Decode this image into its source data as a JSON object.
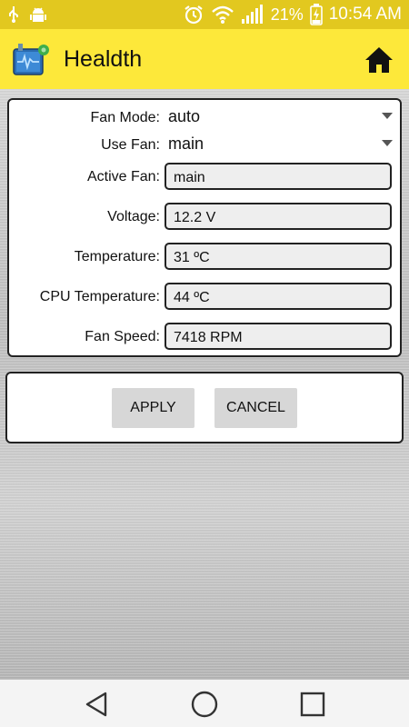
{
  "status_bar": {
    "battery": "21%",
    "time": "10:54 AM",
    "icons": [
      "usb-icon",
      "android-debug-icon",
      "alarm-icon",
      "wifi-icon",
      "signal-icon",
      "battery-charging-icon"
    ]
  },
  "app_bar": {
    "title": "Healdth",
    "logo": "app-logo-icon",
    "home_icon": "home-icon"
  },
  "form": {
    "fan_mode": {
      "label": "Fan Mode:",
      "value": "auto"
    },
    "use_fan": {
      "label": "Use Fan:",
      "value": "main"
    },
    "active_fan": {
      "label": "Active Fan:",
      "value": "main"
    },
    "voltage": {
      "label": "Voltage:",
      "value": "12.2 V"
    },
    "temperature": {
      "label": "Temperature:",
      "value": "31 ºC"
    },
    "cpu_temperature": {
      "label": "CPU Temperature:",
      "value": "44 ºC"
    },
    "fan_speed": {
      "label": "Fan Speed:",
      "value": "7418 RPM"
    }
  },
  "actions": {
    "apply_label": "APPLY",
    "cancel_label": "CANCEL"
  },
  "nav_bar": {
    "icons": [
      "back-icon",
      "home-circle-icon",
      "recents-icon"
    ]
  },
  "colors": {
    "status_bar": "#e2c81f",
    "app_bar": "#fde83a"
  }
}
